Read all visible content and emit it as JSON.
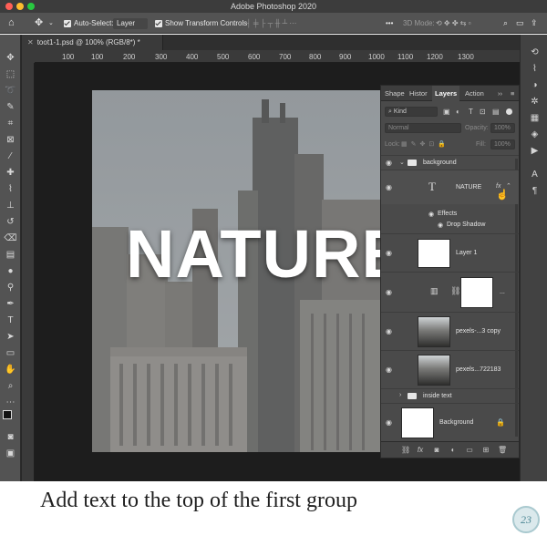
{
  "app": {
    "title": "Adobe Photoshop 2020"
  },
  "options_bar": {
    "auto_select_label": "Auto-Select:",
    "auto_select_value": "Layer",
    "transform_label": "Show Transform Controls",
    "mode_3d_label": "3D Mode:"
  },
  "document": {
    "tab_title": "toot1-1.psd @ 100% (RGB/8*) *",
    "ruler_ticks": [
      "100",
      "100",
      "200",
      "300",
      "400",
      "500",
      "600",
      "700",
      "800",
      "900",
      "1000",
      "1100",
      "1200",
      "1300"
    ],
    "headline_text": "NATURE"
  },
  "layers_panel": {
    "tabs": [
      "Shape",
      "Histor",
      "Layers",
      "Action"
    ],
    "active_tab": "Layers",
    "filter_value": "Kind",
    "blend_mode": "Normal",
    "opacity_label": "Opacity:",
    "opacity_value": "100%",
    "lock_label": "Lock:",
    "fill_label": "Fill:",
    "fill_value": "100%",
    "layers": [
      {
        "name": "background",
        "type": "group"
      },
      {
        "name": "NATURE",
        "type": "text",
        "fx": "fx"
      },
      {
        "name": "Effects",
        "type": "effects"
      },
      {
        "name": "Drop Shadow",
        "type": "effect"
      },
      {
        "name": "Layer 1",
        "type": "pixel"
      },
      {
        "name": "...",
        "type": "adjustment"
      },
      {
        "name": "pexels-...3 copy",
        "type": "image"
      },
      {
        "name": "pexels...722183",
        "type": "image"
      },
      {
        "name": "inside text",
        "type": "group"
      },
      {
        "name": "Background",
        "type": "background"
      }
    ]
  },
  "caption": {
    "text": "Add text to the top of the first group"
  },
  "colors": {
    "panel": "#4a4a4a",
    "toolbar": "#535353",
    "canvas": "#1d1d1d",
    "accent": "#ffffff"
  }
}
